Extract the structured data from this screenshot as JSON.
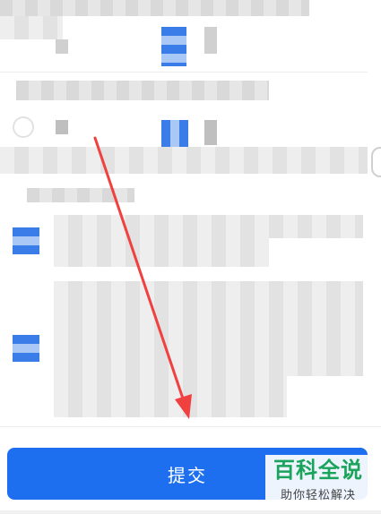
{
  "form": {
    "submit_label": "提交"
  },
  "watermark": {
    "brand": "百科全说",
    "slogan": "助你轻松解决"
  },
  "colors": {
    "primary": "#1e6ff0",
    "arrow": "#f04040",
    "watermark_green": "#1aa35a"
  },
  "icons": {
    "radio": "radio-circle",
    "arrow": "red-arrow-annotation"
  }
}
